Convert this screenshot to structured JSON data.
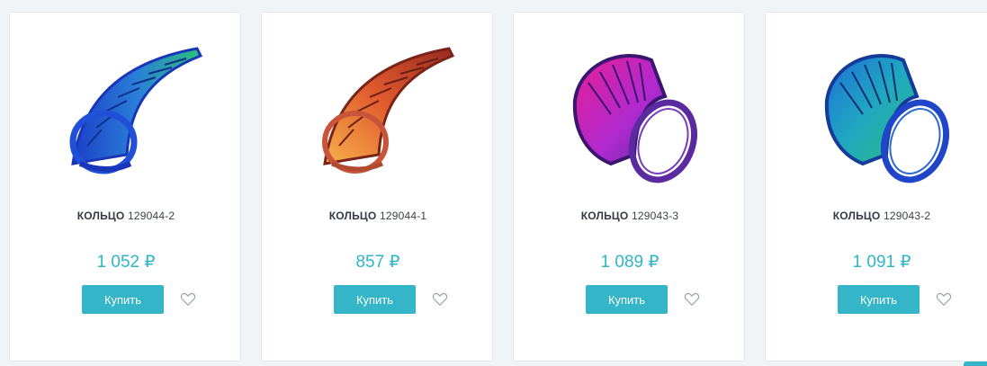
{
  "products": [
    {
      "name": "КОЛЬЦО",
      "code": "129044-2",
      "price": "1 052 ₽",
      "buy_label": "Купить",
      "image_icon": "ring-blue-green-fan-icon",
      "colors": {
        "top": "#1fb8a0",
        "mid": "#2a7fd8",
        "band": "#1f4fd2"
      }
    },
    {
      "name": "КОЛЬЦО",
      "code": "129044-1",
      "price": "857 ₽",
      "buy_label": "Купить",
      "image_icon": "ring-orange-fan-icon",
      "colors": {
        "top": "#b03a1e",
        "mid": "#f0983a",
        "band": "#c8553a"
      }
    },
    {
      "name": "КОЛЬЦО",
      "code": "129043-3",
      "price": "1 089 ₽",
      "buy_label": "Купить",
      "image_icon": "ring-magenta-purple-icon",
      "colors": {
        "top": "#e01f9a",
        "mid": "#8a2bd0",
        "band": "#5a2a9a"
      }
    },
    {
      "name": "КОЛЬЦО",
      "code": "129043-2",
      "price": "1 091 ₽",
      "buy_label": "Купить",
      "image_icon": "ring-blue-teal-icon",
      "colors": {
        "top": "#1f90c8",
        "mid": "#22b89a",
        "band": "#1f45c8"
      }
    }
  ],
  "accent": "#34b6c8",
  "favorite_icon": "heart-outline-icon"
}
